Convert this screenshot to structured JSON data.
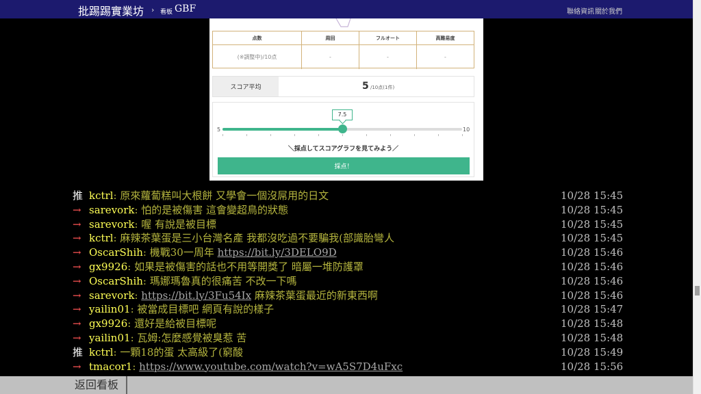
{
  "header": {
    "brand": "批踢踢實業坊",
    "separator": "›",
    "board_label": "看板",
    "board_name": "GBF",
    "links": [
      "聯絡資訊",
      "關於我們"
    ]
  },
  "card": {
    "table_headers": [
      "点数",
      "周回",
      "フルオート",
      "高難易度"
    ],
    "table_values": [
      "(※調整中)/10点",
      "-",
      "-",
      "-"
    ],
    "avg_label": "スコア平均",
    "avg_value": "5",
    "avg_sub": "/10点(1件)",
    "slider": {
      "min": "5",
      "max": "10",
      "value": 7.5,
      "value_label": "7.5",
      "range_min": 5,
      "range_max": 10
    },
    "hint": "＼採点してスコアグラフを見てみよう／",
    "button": "採点！",
    "accent_color": "#3fb58c"
  },
  "pushes": [
    {
      "tag": "推",
      "user": "kctrl",
      "content": ": 原來蘿蔔糕叫大根餅 又學會一個沒屌用的日文",
      "link": "",
      "after": "",
      "time": "10/28 15:45"
    },
    {
      "tag": "→",
      "user": "sarevork",
      "content": ": 怕的是被傷害 這會變超鳥的狀態",
      "link": "",
      "after": "",
      "time": "10/28 15:45"
    },
    {
      "tag": "→",
      "user": "sarevork",
      "content": ": 喔 有說是被目標",
      "link": "",
      "after": "",
      "time": "10/28 15:45"
    },
    {
      "tag": "→",
      "user": "kctrl",
      "content": ": 麻辣茶葉蛋是三小台灣名產 我都沒吃過不要騙我(部識胎彎人",
      "link": "",
      "after": "",
      "time": "10/28 15:45"
    },
    {
      "tag": "→",
      "user": "OscarShih",
      "content": ": 機戰30一周年  ",
      "link": "https://bit.ly/3DELO9D",
      "after": "",
      "time": "10/28 15:46"
    },
    {
      "tag": "→",
      "user": "gx9926",
      "content": ": 如果是被傷害的話也不用等開獎了 暗屬一堆防護罩",
      "link": "",
      "after": "",
      "time": "10/28 15:46"
    },
    {
      "tag": "→",
      "user": "OscarShih",
      "content": ": 瑪娜瑪魯真的很痛苦 不改一下嗎",
      "link": "",
      "after": "",
      "time": "10/28 15:46"
    },
    {
      "tag": "→",
      "user": "sarevork",
      "content": ": ",
      "link": "https://bit.ly/3Fu54Ix",
      "after": " 麻辣茶葉蛋最近的新東西啊",
      "time": "10/28 15:46"
    },
    {
      "tag": "→",
      "user": "yailin01",
      "content": ": 被當成目標吧 網頁有說的樣子",
      "link": "",
      "after": "",
      "time": "10/28 15:47"
    },
    {
      "tag": "→",
      "user": "gx9926",
      "content": ": 還好是給被目標呢",
      "link": "",
      "after": "",
      "time": "10/28 15:48"
    },
    {
      "tag": "→",
      "user": "yailin01",
      "content": ": 瓦姆:怎麼感覺被臭惹 苦",
      "link": "",
      "after": "",
      "time": "10/28 15:48"
    },
    {
      "tag": "推",
      "user": "kctrl",
      "content": ": 一顆18的蛋 太高級了(窮酸",
      "link": "",
      "after": "",
      "time": "10/28 15:49"
    },
    {
      "tag": "→",
      "user": "tmacor1",
      "content": ": ",
      "link": "https://www.youtube.com/watch?v=wA5S7D4uFxc",
      "after": "",
      "time": "10/28 15:56"
    }
  ],
  "footer": {
    "back_label": "返回看板"
  }
}
